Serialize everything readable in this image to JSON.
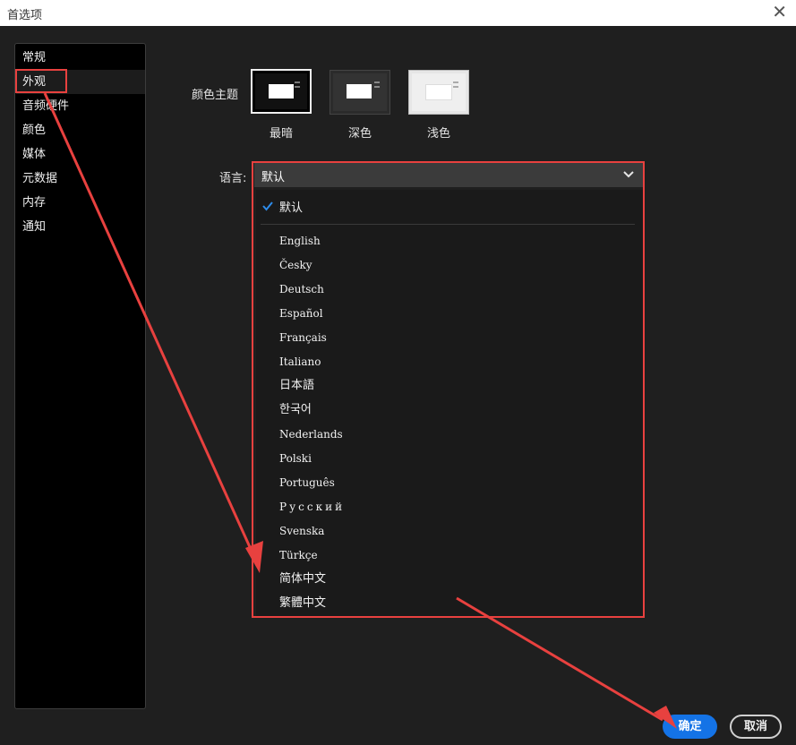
{
  "window": {
    "title": "首选项"
  },
  "sidebar": {
    "items": [
      {
        "label": "常规"
      },
      {
        "label": "外观",
        "selected": true
      },
      {
        "label": "音频硬件"
      },
      {
        "label": "颜色"
      },
      {
        "label": "媒体"
      },
      {
        "label": "元数据"
      },
      {
        "label": "内存"
      },
      {
        "label": "通知"
      }
    ]
  },
  "appearance": {
    "theme_label": "颜色主题",
    "themes": [
      {
        "label": "最暗",
        "selected": true
      },
      {
        "label": "深色"
      },
      {
        "label": "浅色"
      }
    ],
    "language_label": "语言:",
    "language_value": "默认",
    "language_options": [
      {
        "label": "默认",
        "checked": true
      },
      {
        "label": "English"
      },
      {
        "label": "Česky"
      },
      {
        "label": "Deutsch"
      },
      {
        "label": "Español"
      },
      {
        "label": "Français"
      },
      {
        "label": "Italiano"
      },
      {
        "label": "日本語"
      },
      {
        "label": "한국어"
      },
      {
        "label": "Nederlands"
      },
      {
        "label": "Polski"
      },
      {
        "label": "Português"
      },
      {
        "label": "Русский"
      },
      {
        "label": "Svenska"
      },
      {
        "label": "Türkçe"
      },
      {
        "label": "简体中文"
      },
      {
        "label": "繁體中文"
      }
    ]
  },
  "footer": {
    "ok_label": "确定",
    "cancel_label": "取消"
  },
  "colors": {
    "accent": "#1473e6",
    "annotation": "#e8413f"
  },
  "icons": [
    "close-icon",
    "chevron-down-icon",
    "checkmark-icon"
  ]
}
